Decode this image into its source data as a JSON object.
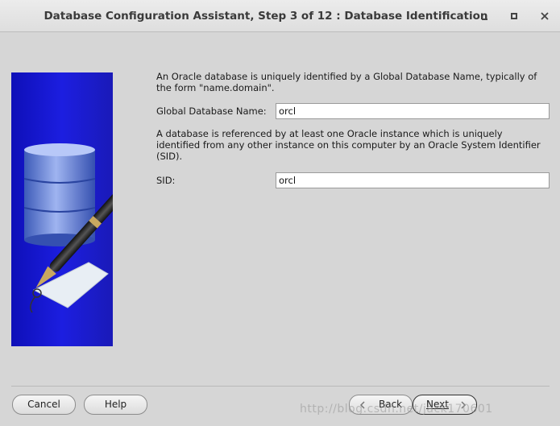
{
  "window": {
    "title": "Database Configuration Assistant, Step 3 of 12 : Database Identification",
    "minimize_icon": "minimize-icon",
    "maximize_icon": "maximize-icon",
    "close_icon": "close-icon"
  },
  "illustration": {
    "icon": "database-pen-tag-icon"
  },
  "form": {
    "description_1": "An Oracle database is uniquely identified by a Global Database Name, typically of the form \"name.domain\".",
    "global_db_name_label": "Global Database Name:",
    "global_db_name_value": "orcl",
    "description_2": "A database is referenced by at least one Oracle instance which is uniquely identified from any other instance on this computer by an Oracle System Identifier (SID).",
    "sid_label": "SID:",
    "sid_value": "orcl"
  },
  "buttons": {
    "cancel": "Cancel",
    "help": "Help",
    "back": "Back",
    "next": "Next"
  },
  "watermark": "http://blog.csdn.net/jack170601"
}
